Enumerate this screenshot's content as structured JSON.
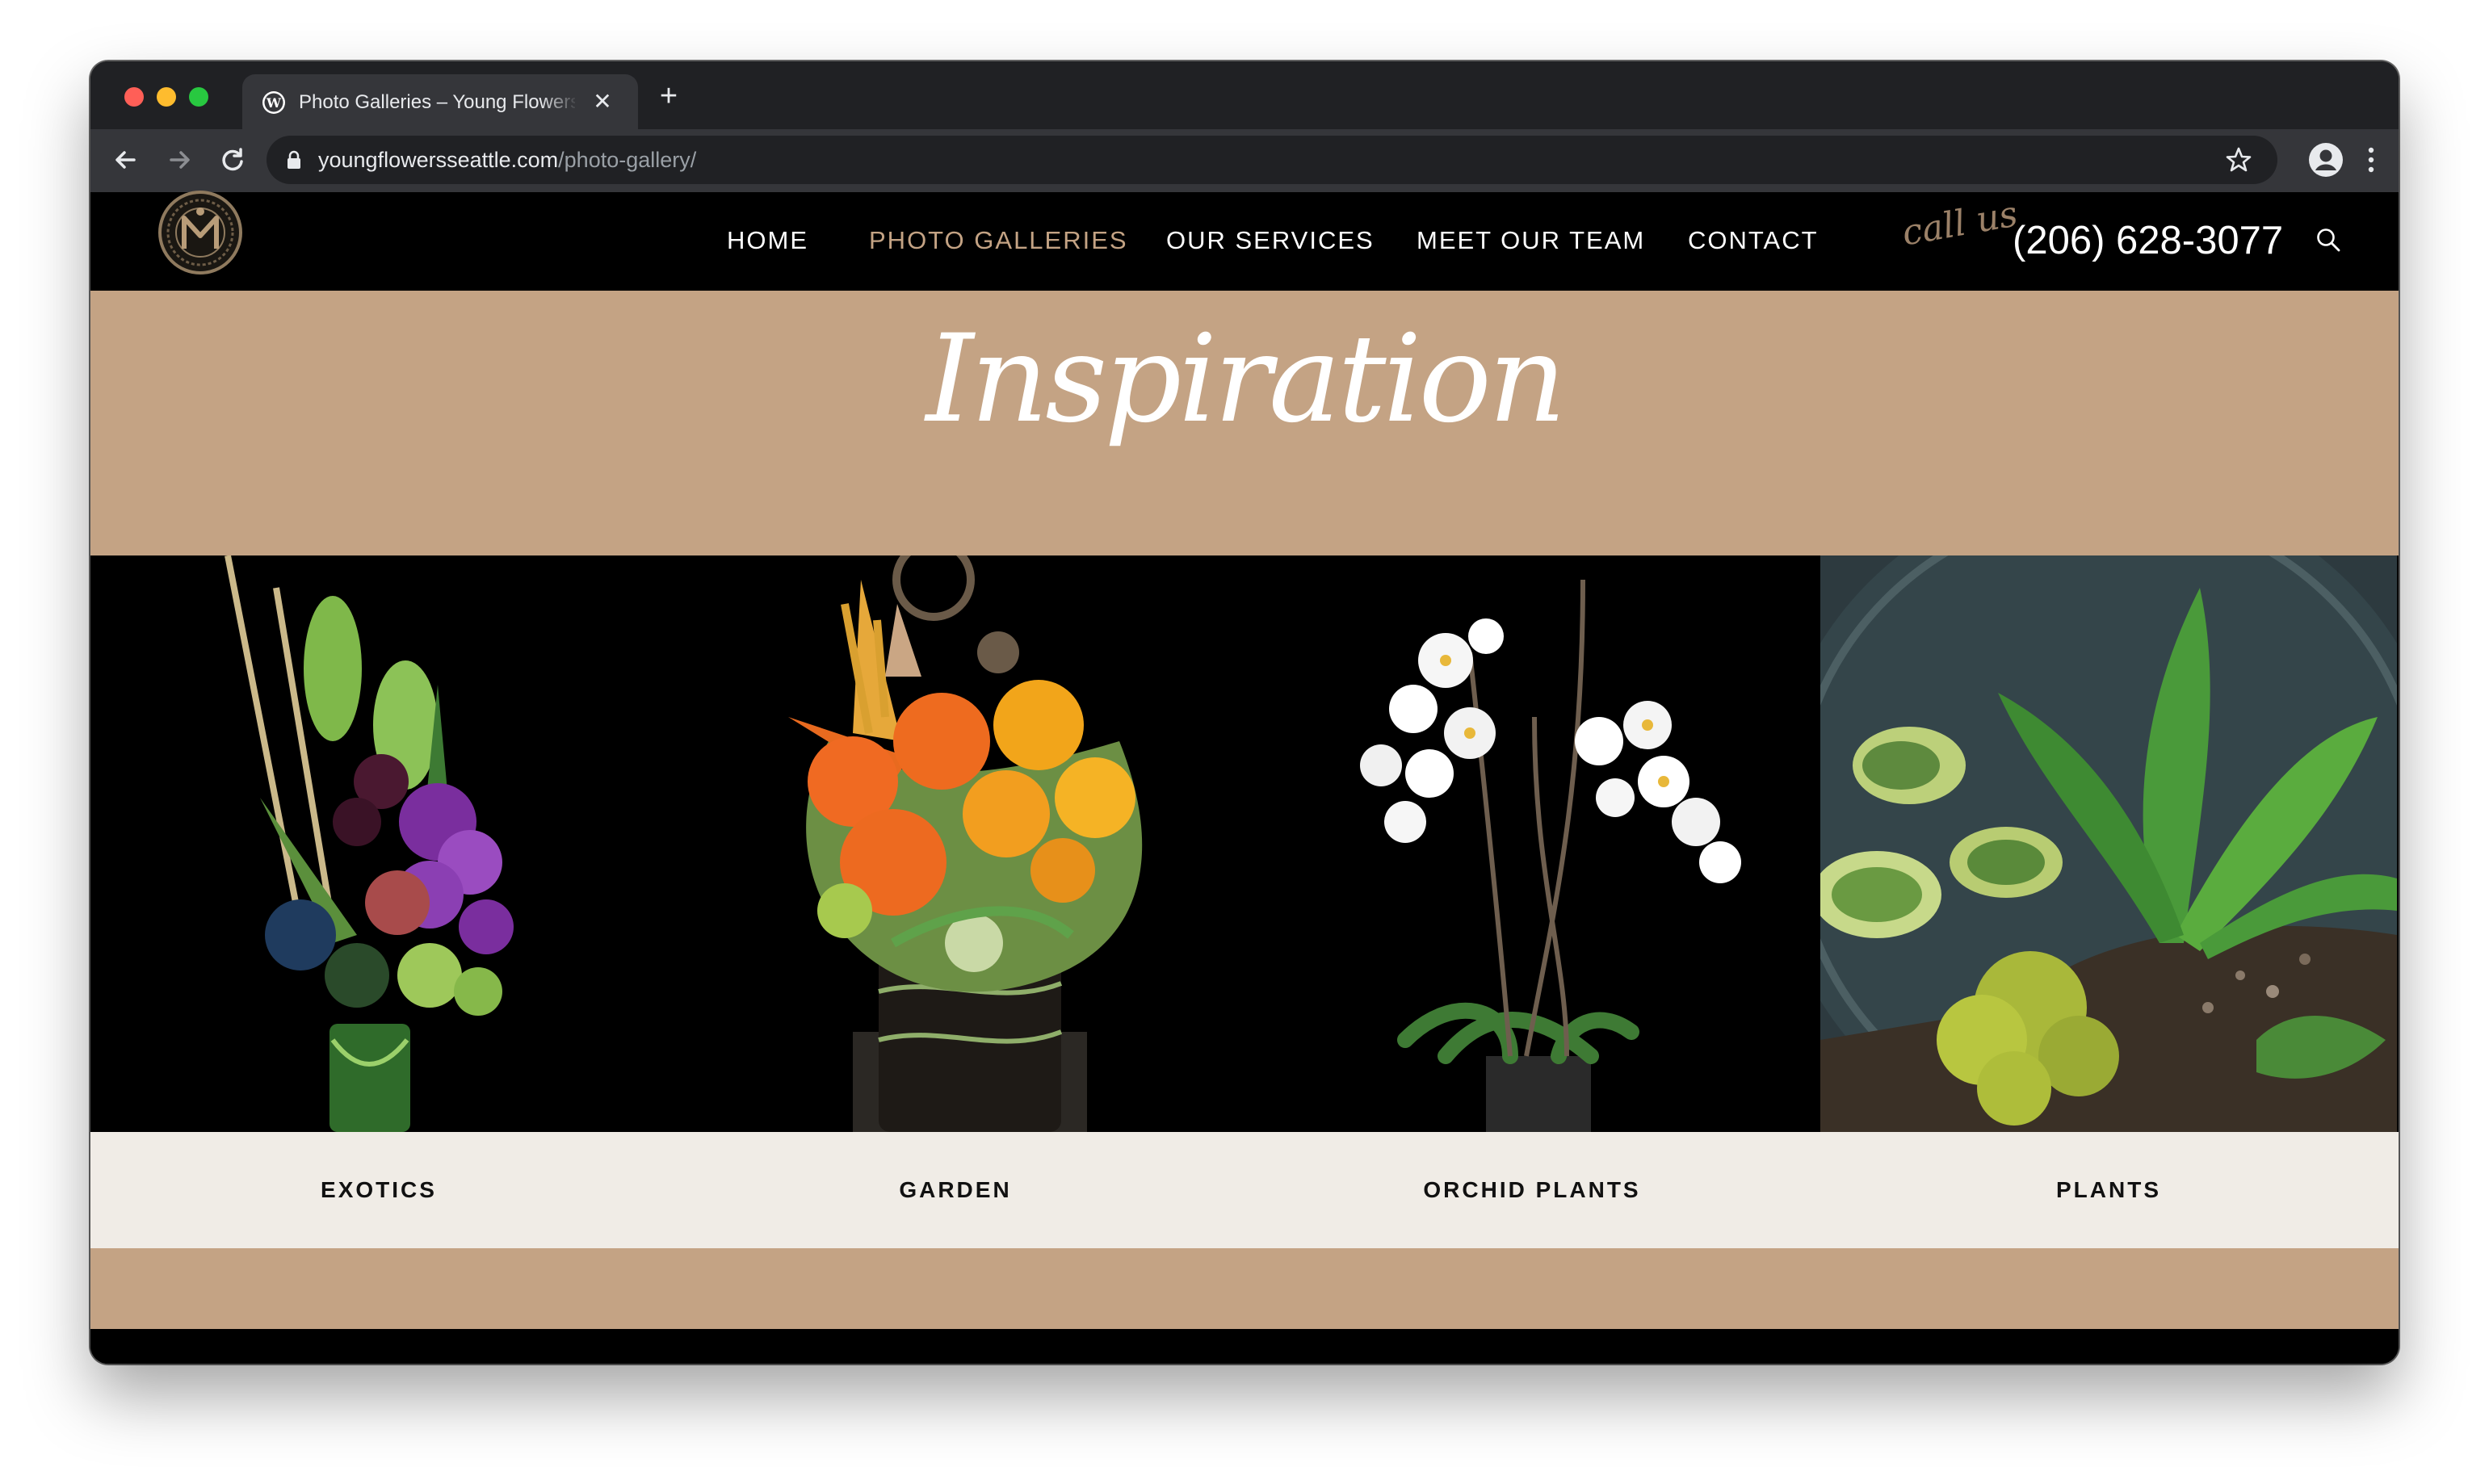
{
  "browser": {
    "tab_title": "Photo Galleries – Young Flowers",
    "url_host": "youngflowersseattle.com",
    "url_path": "/photo-gallery/",
    "new_tab_label": "+",
    "close_label": "✕"
  },
  "header": {
    "nav": [
      "HOME",
      "PHOTO GALLERIES",
      "OUR SERVICES",
      "MEET OUR TEAM",
      "CONTACT"
    ],
    "active_nav": "PHOTO GALLERIES",
    "call_us": "call us",
    "phone": "(206) 628-3077"
  },
  "banner": {
    "title": "Inspiration"
  },
  "gallery": {
    "items": [
      {
        "label": "EXOTICS",
        "icon": "exotics-arrangement-photo"
      },
      {
        "label": "GARDEN",
        "icon": "garden-arrangement-photo"
      },
      {
        "label": "ORCHID PLANTS",
        "icon": "orchid-plant-photo"
      },
      {
        "label": "PLANTS",
        "icon": "terrarium-plants-photo"
      }
    ]
  },
  "colors": {
    "accent_tan": "#c4a384",
    "label_bg": "#f0ece6",
    "page_bg": "#000000",
    "chrome_dark": "#202124",
    "chrome_mid": "#35363a"
  }
}
